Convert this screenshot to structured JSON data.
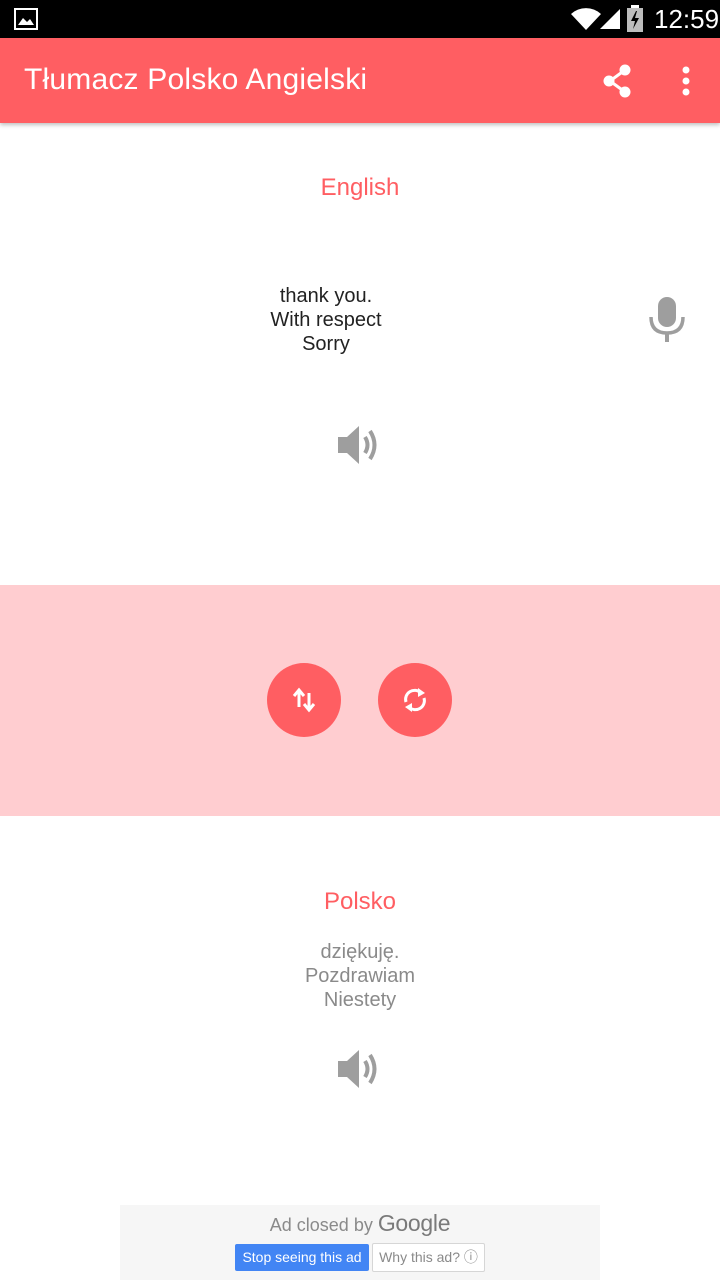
{
  "status_bar": {
    "time": "12:59"
  },
  "app_bar": {
    "title": "Tłumacz Polsko Angielski",
    "share_icon": "share-icon",
    "more_icon": "more-vert-icon"
  },
  "source": {
    "language": "English",
    "lines": [
      "thank you.",
      "With respect",
      "Sorry"
    ],
    "mic_icon": "microphone-icon",
    "speaker_icon": "speaker-icon"
  },
  "controls": {
    "swap_icon": "swap-vert-icon",
    "refresh_icon": "refresh-icon"
  },
  "target": {
    "language": "Polsko",
    "lines": [
      "dziękuję.",
      "Pozdrawiam",
      "Niestety"
    ],
    "speaker_icon": "speaker-icon"
  },
  "ad": {
    "closed_prefix": "Ad closed by",
    "brand": "Google",
    "stop_label": "Stop seeing this ad",
    "why_label": "Why this ad? ⓘ"
  },
  "colors": {
    "accent": "#ff5e62",
    "band": "#ffcdd0",
    "icon_gray": "#9e9e9e"
  }
}
